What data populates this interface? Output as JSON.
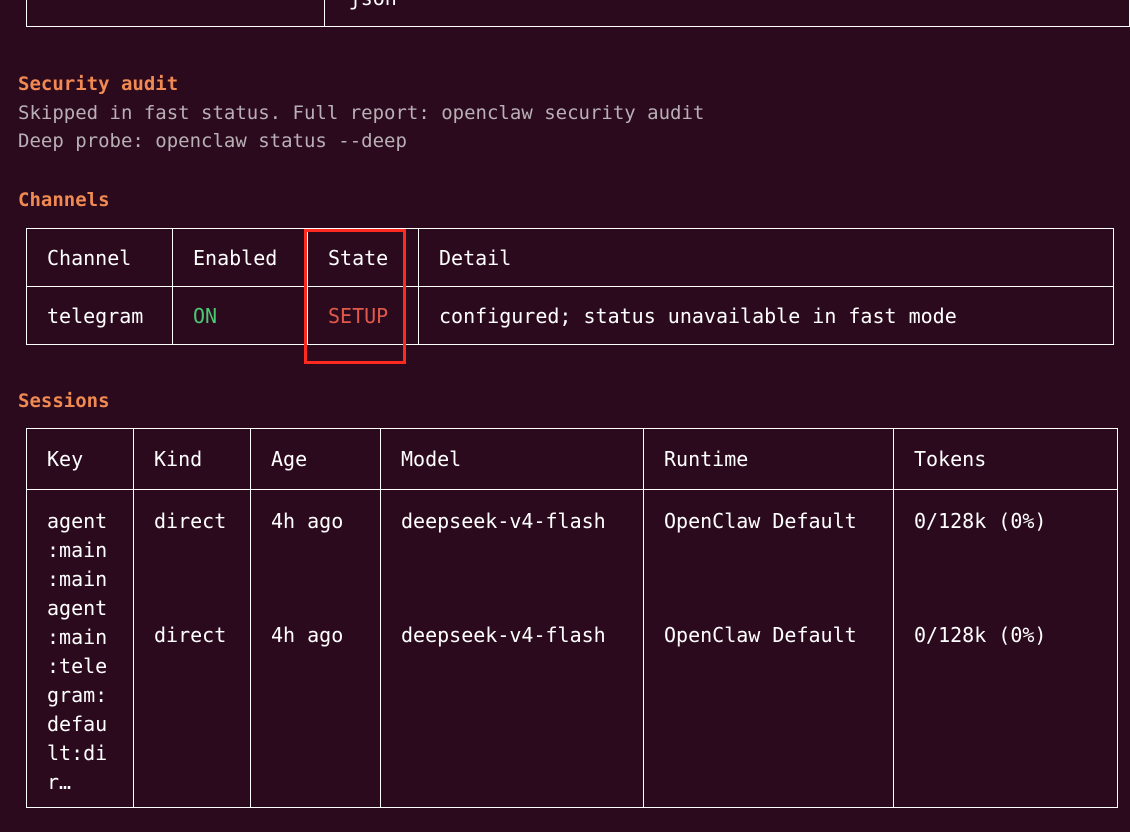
{
  "top_fragment": {
    "text": "json"
  },
  "security_audit": {
    "title": "Security audit",
    "line1": "Skipped in fast status. Full report: openclaw security audit",
    "line2": "Deep probe: openclaw status --deep"
  },
  "channels": {
    "title": "Channels",
    "headers": [
      "Channel",
      "Enabled",
      "State",
      "Detail"
    ],
    "rows": [
      {
        "channel": "telegram",
        "enabled": "ON",
        "state": "SETUP",
        "detail": "configured; status unavailable in fast mode"
      }
    ]
  },
  "sessions": {
    "title": "Sessions",
    "headers": [
      "Key",
      "Kind",
      "Age",
      "Model",
      "Runtime",
      "Tokens"
    ],
    "rows": [
      {
        "key_lines": [
          "agent",
          ":main",
          ":main"
        ],
        "kind": "direct",
        "age": "4h ago",
        "model": "deepseek-v4-flash",
        "runtime": "OpenClaw Default",
        "tokens": "0/128k (0%)"
      },
      {
        "key_lines": [
          "agent",
          ":main",
          ":tele",
          "gram:",
          "defau",
          "lt:di",
          "r…"
        ],
        "kind": "direct",
        "age": "4h ago",
        "model": "deepseek-v4-flash",
        "runtime": "OpenClaw Default",
        "tokens": "0/128k (0%)"
      }
    ]
  },
  "colors": {
    "background": "#2c0a1e",
    "section_title": "#f08a52",
    "enabled_on": "#4bc874",
    "state_setup": "#e05a4b",
    "highlight_box": "#ff2a1f"
  }
}
